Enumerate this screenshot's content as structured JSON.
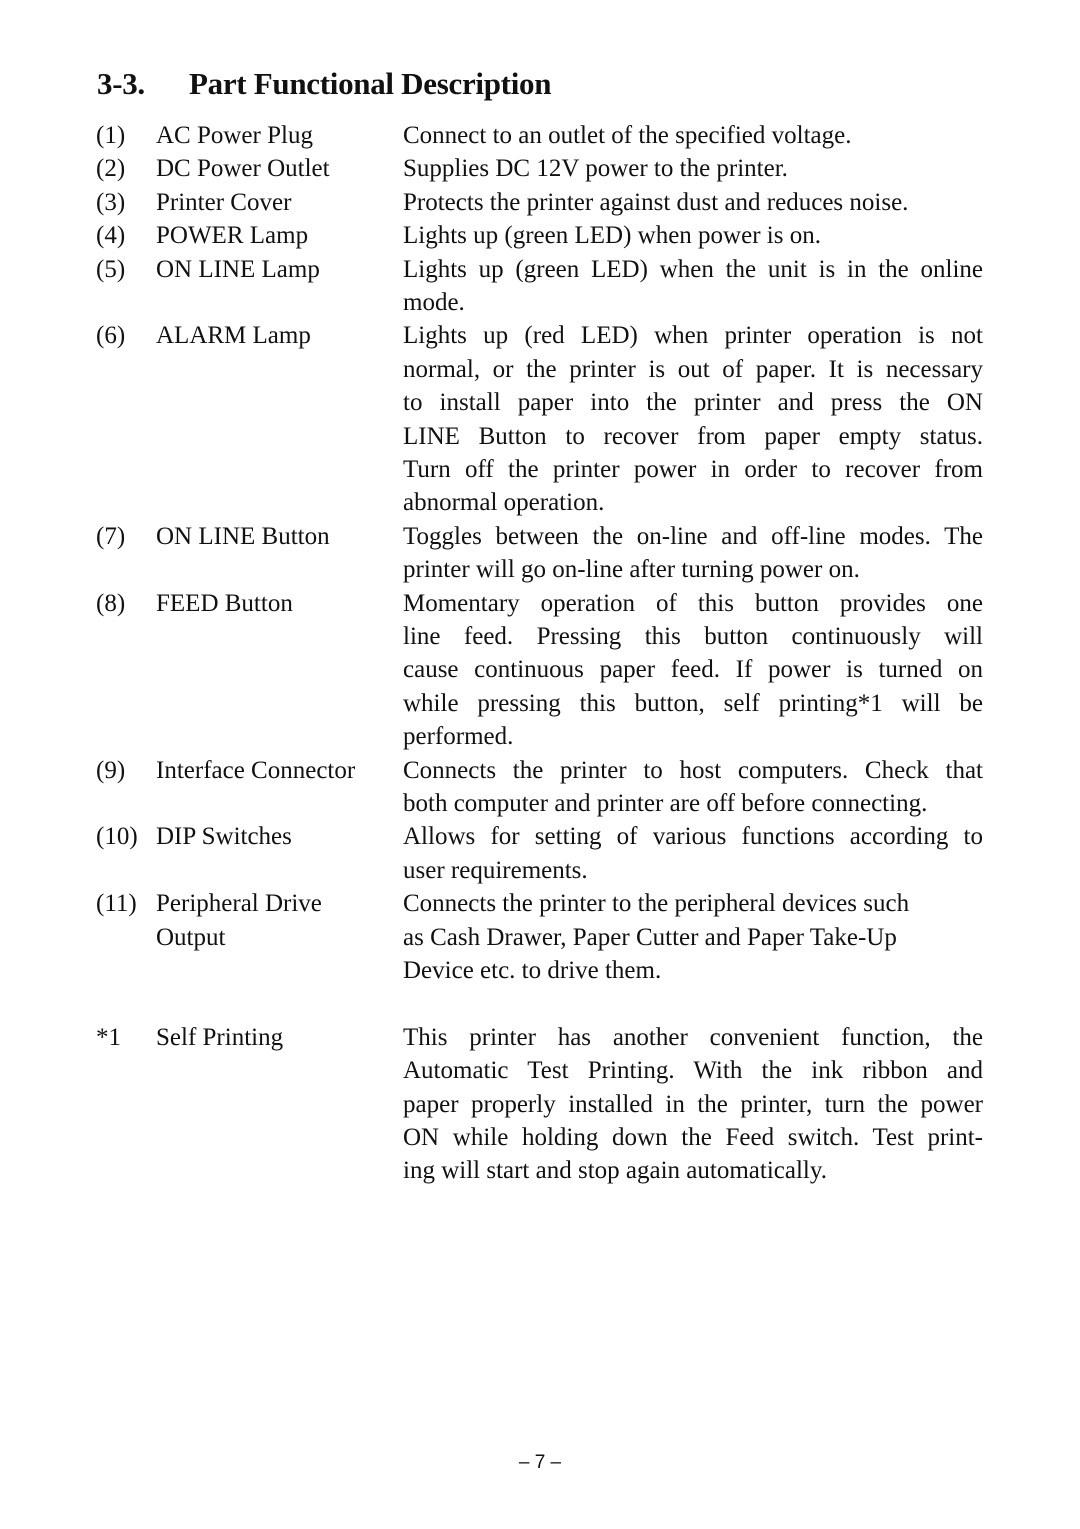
{
  "section": {
    "number": "3-3.",
    "title": "Part Functional Description"
  },
  "items": [
    {
      "index": "(1)",
      "name": [
        "AC Power Plug"
      ],
      "description": [
        "Connect to an outlet of the specified voltage."
      ]
    },
    {
      "index": "(2)",
      "name": [
        "DC Power Outlet"
      ],
      "description": [
        "Supplies DC 12V power to the printer."
      ]
    },
    {
      "index": "(3)",
      "name": [
        "Printer Cover"
      ],
      "description": [
        "Protects the printer against dust and reduces noise."
      ]
    },
    {
      "index": "(4)",
      "name": [
        "POWER Lamp"
      ],
      "description": [
        "Lights up (green LED) when power is on."
      ]
    },
    {
      "index": "(5)",
      "name": [
        "ON LINE Lamp"
      ],
      "description": [
        "Lights up (green LED) when the unit is in the online",
        "mode."
      ]
    },
    {
      "index": "(6)",
      "name": [
        "ALARM Lamp"
      ],
      "description": [
        "Lights up (red LED) when printer operation is not",
        "normal, or the printer is out of paper. It is necessary",
        "to install paper into the printer and press the ON",
        "LINE Button to recover from paper empty status.",
        "Turn off the printer power in order to recover from",
        "abnormal operation."
      ]
    },
    {
      "index": "(7)",
      "name": [
        "ON LINE Button"
      ],
      "description": [
        "Toggles between the on-line and off-line modes. The",
        "printer will go on-line after turning power on."
      ]
    },
    {
      "index": "(8)",
      "name": [
        "FEED Button"
      ],
      "description": [
        "Momentary operation of this button provides one",
        "line feed. Pressing this button continuously will",
        "cause continuous paper feed. If power is turned on",
        "while pressing this button, self printing*1 will be",
        "performed."
      ]
    },
    {
      "index": "(9)",
      "name": [
        "Interface Connector"
      ],
      "description": [
        "Connects the printer to host computers. Check that",
        "both computer and printer are off before connecting."
      ]
    },
    {
      "index": "(10)",
      "name": [
        "DIP Switches"
      ],
      "description": [
        "Allows for setting of various functions according to",
        "user requirements."
      ]
    },
    {
      "index": "(11)",
      "name": [
        "Peripheral Drive",
        "Output"
      ],
      "description": [
        "Connects the printer to the peripheral devices such",
        "as Cash Drawer, Paper Cutter and Paper Take-Up",
        "Device etc. to drive them."
      ]
    }
  ],
  "footnote": {
    "index": "*1",
    "name": [
      "Self Printing"
    ],
    "description": [
      "This printer has another convenient function, the",
      "Automatic Test Printing. With the ink ribbon and",
      "paper properly installed in the printer, turn the power",
      "ON while holding down the Feed switch. Test print-",
      "ing will start and stop again automatically."
    ]
  },
  "page_number": "– 7 –"
}
